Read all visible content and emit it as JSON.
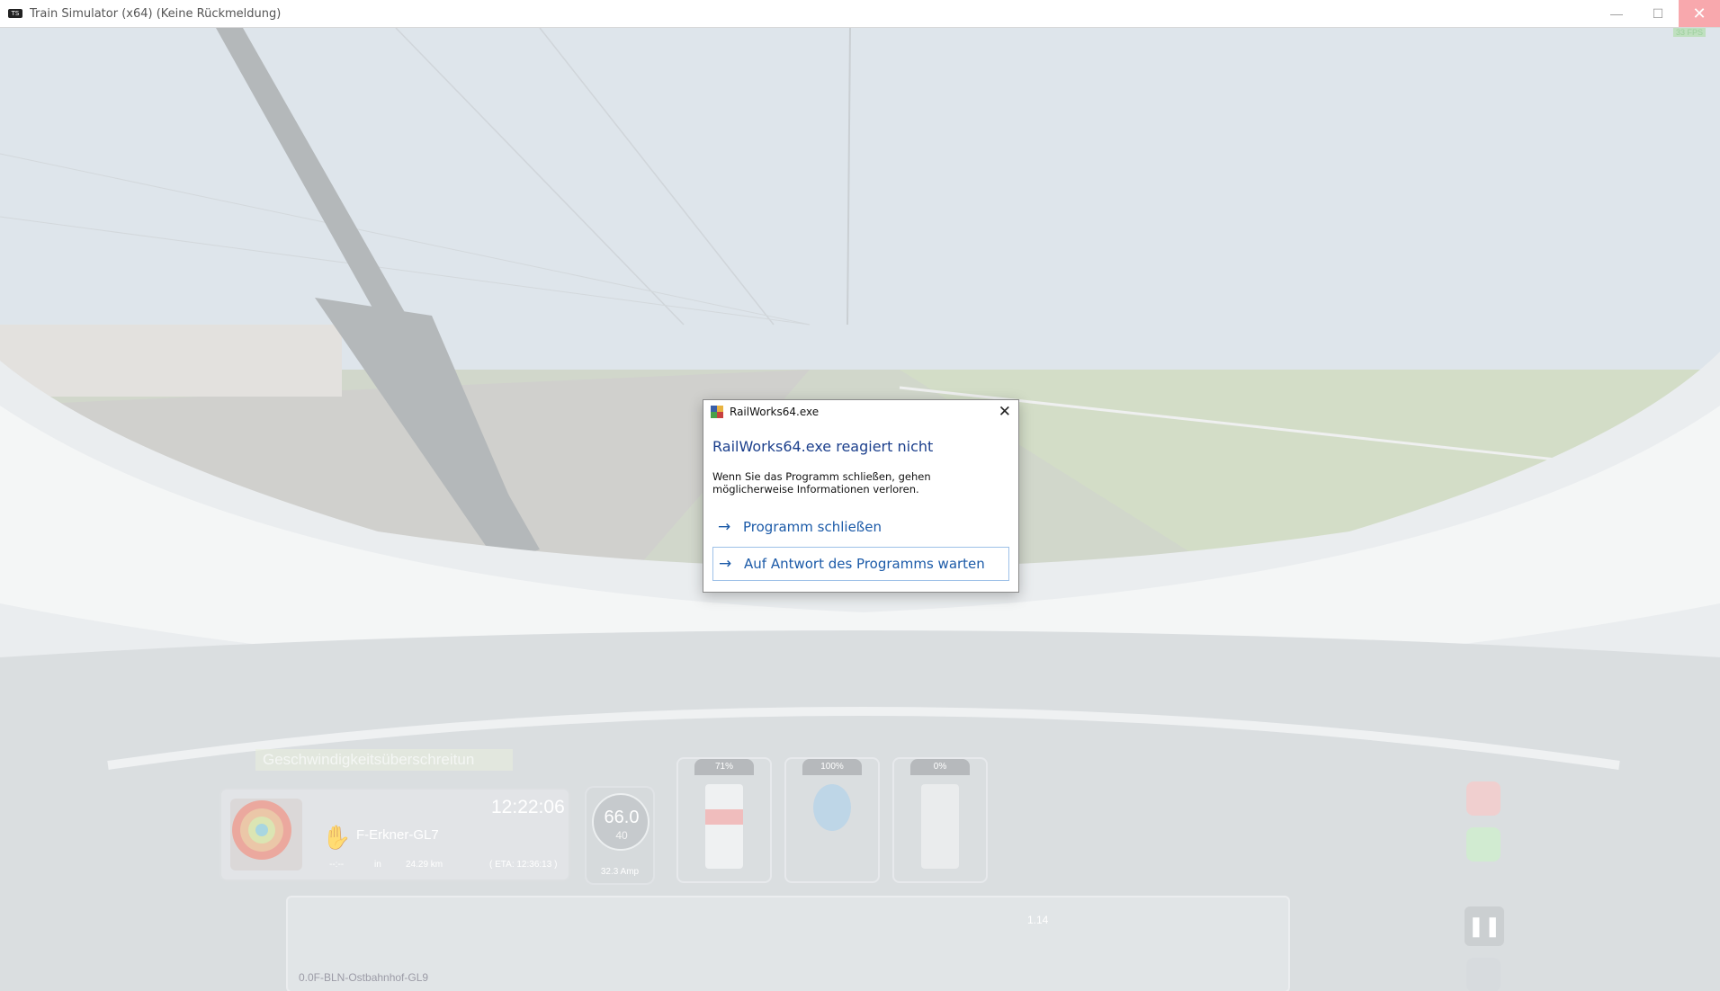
{
  "window": {
    "title": "Train Simulator (x64) (Keine Rückmeldung)",
    "app_icon_text": "TS",
    "minimize_glyph": "—",
    "maximize_glyph": "☐",
    "close_glyph": "✕",
    "fps_badge": "33 FPS"
  },
  "hud": {
    "speed_warning": "Geschwindigkeitsüberschreitun",
    "clock": "12:22:06",
    "next_station": "F-Erkner-GL7",
    "distance_prefix": "--:--",
    "distance_in": "in",
    "distance_km": "24.29 km",
    "eta": "( ETA: 12:36:13 )",
    "speed_current": "66.0",
    "speed_limit": "40",
    "amperage": "32.3 Amp",
    "lever_throttle_pct": "71%",
    "lever_reverser_pct": "100%",
    "lever_brake_pct": "0%",
    "track_distance_marker": "1.14",
    "track_next_label": "0.0F-BLN-Ostbahnhof-GL9",
    "pause_glyph": "❚❚"
  },
  "dialog": {
    "title": "RailWorks64.exe",
    "close_glyph": "✕",
    "heading": "RailWorks64.exe reagiert nicht",
    "message": "Wenn Sie das Programm schließen, gehen möglicherweise Informationen verloren.",
    "options": [
      {
        "label": "Programm schließen",
        "icon": "arrow-right-icon"
      },
      {
        "label": "Auf Antwort des Programms warten",
        "icon": "arrow-right-icon"
      }
    ],
    "arrow_glyph": "→"
  },
  "colors": {
    "dialog_heading": "#1b3f8c",
    "dialog_link": "#1b5aa8",
    "close_hover": "#e81123"
  }
}
